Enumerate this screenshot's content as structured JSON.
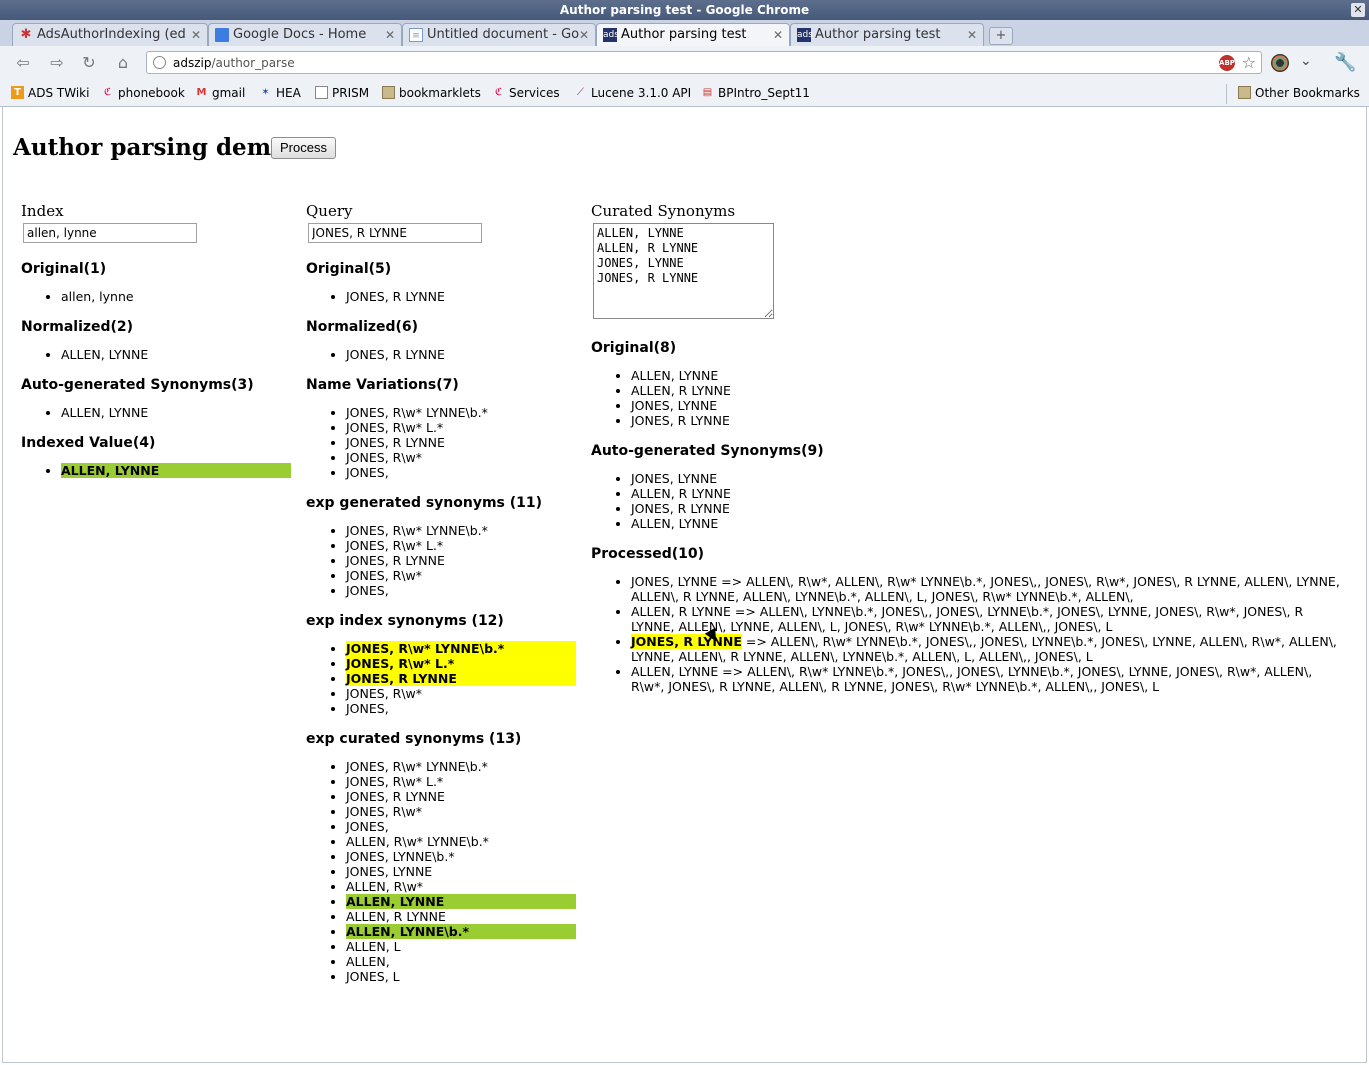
{
  "window": {
    "title": "Author parsing test - Google Chrome"
  },
  "tabs": [
    {
      "label": "AdsAuthorIndexing (ed",
      "active": false
    },
    {
      "label": "Google Docs - Home",
      "active": false
    },
    {
      "label": "Untitled document - Go",
      "active": false
    },
    {
      "label": "Author parsing test",
      "active": true
    },
    {
      "label": "Author parsing test",
      "active": false
    }
  ],
  "omnibox": {
    "host": "adszip",
    "path": "/author_parse"
  },
  "bookmarks": [
    "ADS TWiki",
    "phonebook",
    "gmail",
    "HEA",
    "PRISM",
    "bookmarklets",
    "Services",
    "Lucene 3.1.0 API",
    "BPIntro_Sept11"
  ],
  "other_bookmarks": "Other Bookmarks",
  "page": {
    "title": "Author parsing demo",
    "process_button": "Process",
    "index": {
      "label": "Index",
      "value": "allen, lynne",
      "sections": [
        {
          "heading": "Original(1)",
          "items": [
            {
              "text": "allen, lynne"
            }
          ]
        },
        {
          "heading": "Normalized(2)",
          "items": [
            {
              "text": "ALLEN, LYNNE"
            }
          ]
        },
        {
          "heading": "Auto-generated Synonyms(3)",
          "items": [
            {
              "text": "ALLEN, LYNNE"
            }
          ]
        },
        {
          "heading": "Indexed Value(4)",
          "items": [
            {
              "text": "ALLEN, LYNNE",
              "hl": "green"
            }
          ]
        }
      ]
    },
    "query": {
      "label": "Query",
      "value": "JONES, R LYNNE",
      "sections": [
        {
          "heading": "Original(5)",
          "items": [
            {
              "text": "JONES, R LYNNE"
            }
          ]
        },
        {
          "heading": "Normalized(6)",
          "items": [
            {
              "text": "JONES, R LYNNE"
            }
          ]
        },
        {
          "heading": "Name Variations(7)",
          "items": [
            {
              "text": "JONES, R\\w* LYNNE\\b.*"
            },
            {
              "text": "JONES, R\\w* L.*"
            },
            {
              "text": "JONES, R LYNNE"
            },
            {
              "text": "JONES, R\\w*"
            },
            {
              "text": "JONES,"
            }
          ]
        },
        {
          "heading": "exp generated synonyms (11)",
          "items": [
            {
              "text": "JONES, R\\w* LYNNE\\b.*"
            },
            {
              "text": "JONES, R\\w* L.*"
            },
            {
              "text": "JONES, R LYNNE"
            },
            {
              "text": "JONES, R\\w*"
            },
            {
              "text": "JONES,"
            }
          ]
        },
        {
          "heading": "exp index synonyms (12)",
          "items": [
            {
              "text": "JONES, R\\w* LYNNE\\b.*",
              "hl": "yellow"
            },
            {
              "text": "JONES, R\\w* L.*",
              "hl": "yellow"
            },
            {
              "text": "JONES, R LYNNE",
              "hl": "yellow"
            },
            {
              "text": "JONES, R\\w*"
            },
            {
              "text": "JONES,"
            }
          ]
        },
        {
          "heading": "exp curated synonyms (13)",
          "items": [
            {
              "text": "JONES, R\\w* LYNNE\\b.*"
            },
            {
              "text": "JONES, R\\w* L.*"
            },
            {
              "text": "JONES, R LYNNE"
            },
            {
              "text": "JONES, R\\w*"
            },
            {
              "text": "JONES,"
            },
            {
              "text": "ALLEN, R\\w* LYNNE\\b.*"
            },
            {
              "text": "JONES, LYNNE\\b.*"
            },
            {
              "text": "JONES, LYNNE"
            },
            {
              "text": "ALLEN, R\\w*"
            },
            {
              "text": "ALLEN, LYNNE",
              "hl": "green"
            },
            {
              "text": "ALLEN, R LYNNE"
            },
            {
              "text": "ALLEN, LYNNE\\b.*",
              "hl": "green"
            },
            {
              "text": "ALLEN, L"
            },
            {
              "text": "ALLEN,"
            },
            {
              "text": "JONES, L"
            }
          ]
        }
      ]
    },
    "curated": {
      "label": "Curated Synonyms",
      "value": "ALLEN, LYNNE\nALLEN, R LYNNE\nJONES, LYNNE\nJONES, R LYNNE",
      "sections": [
        {
          "heading": "Original(8)",
          "items": [
            {
              "text": "ALLEN, LYNNE"
            },
            {
              "text": "ALLEN, R LYNNE"
            },
            {
              "text": "JONES, LYNNE"
            },
            {
              "text": "JONES, R LYNNE"
            }
          ]
        },
        {
          "heading": "Auto-generated Synonyms(9)",
          "items": [
            {
              "text": "JONES, LYNNE"
            },
            {
              "text": "ALLEN, R LYNNE"
            },
            {
              "text": "JONES, R LYNNE"
            },
            {
              "text": "ALLEN, LYNNE"
            }
          ]
        },
        {
          "heading": "Processed(10)",
          "items": [
            {
              "text": "JONES, LYNNE => ALLEN\\, R\\w*, ALLEN\\, R\\w* LYNNE\\b.*, JONES\\,, JONES\\, R\\w*, JONES\\, R LYNNE, ALLEN\\, LYNNE, ALLEN\\, R LYNNE, ALLEN\\, LYNNE\\b.*, ALLEN\\, L, JONES\\, R\\w* LYNNE\\b.*, ALLEN\\,"
            },
            {
              "text": "ALLEN, R LYNNE => ALLEN\\, LYNNE\\b.*, JONES\\,, JONES\\, LYNNE\\b.*, JONES\\, LYNNE, JONES\\, R\\w*, JONES\\, R LYNNE, ALLEN\\, LYNNE, ALLEN\\, L, JONES\\, R\\w* LYNNE\\b.*, ALLEN\\,, JONES\\, L"
            },
            {
              "lead": "JONES, R LYNNE",
              "text": " => ALLEN\\, R\\w* LYNNE\\b.*, JONES\\,, JONES\\, LYNNE\\b.*, JONES\\, LYNNE, ALLEN\\, R\\w*, ALLEN\\, LYNNE, ALLEN\\, R LYNNE, ALLEN\\, LYNNE\\b.*, ALLEN\\, L, ALLEN\\,, JONES\\, L"
            },
            {
              "text": "ALLEN, LYNNE => ALLEN\\, R\\w* LYNNE\\b.*, JONES\\,, JONES\\, LYNNE\\b.*, JONES\\, LYNNE, JONES\\, R\\w*, ALLEN\\, R\\w*, JONES\\, R LYNNE, ALLEN\\, R LYNNE, JONES\\, R\\w* LYNNE\\b.*, ALLEN\\,, JONES\\, L"
            }
          ]
        }
      ]
    }
  },
  "colors": {
    "highlight_yellow": "#ffff00",
    "highlight_green": "#9acd32",
    "titlebar": "#4f6285"
  }
}
